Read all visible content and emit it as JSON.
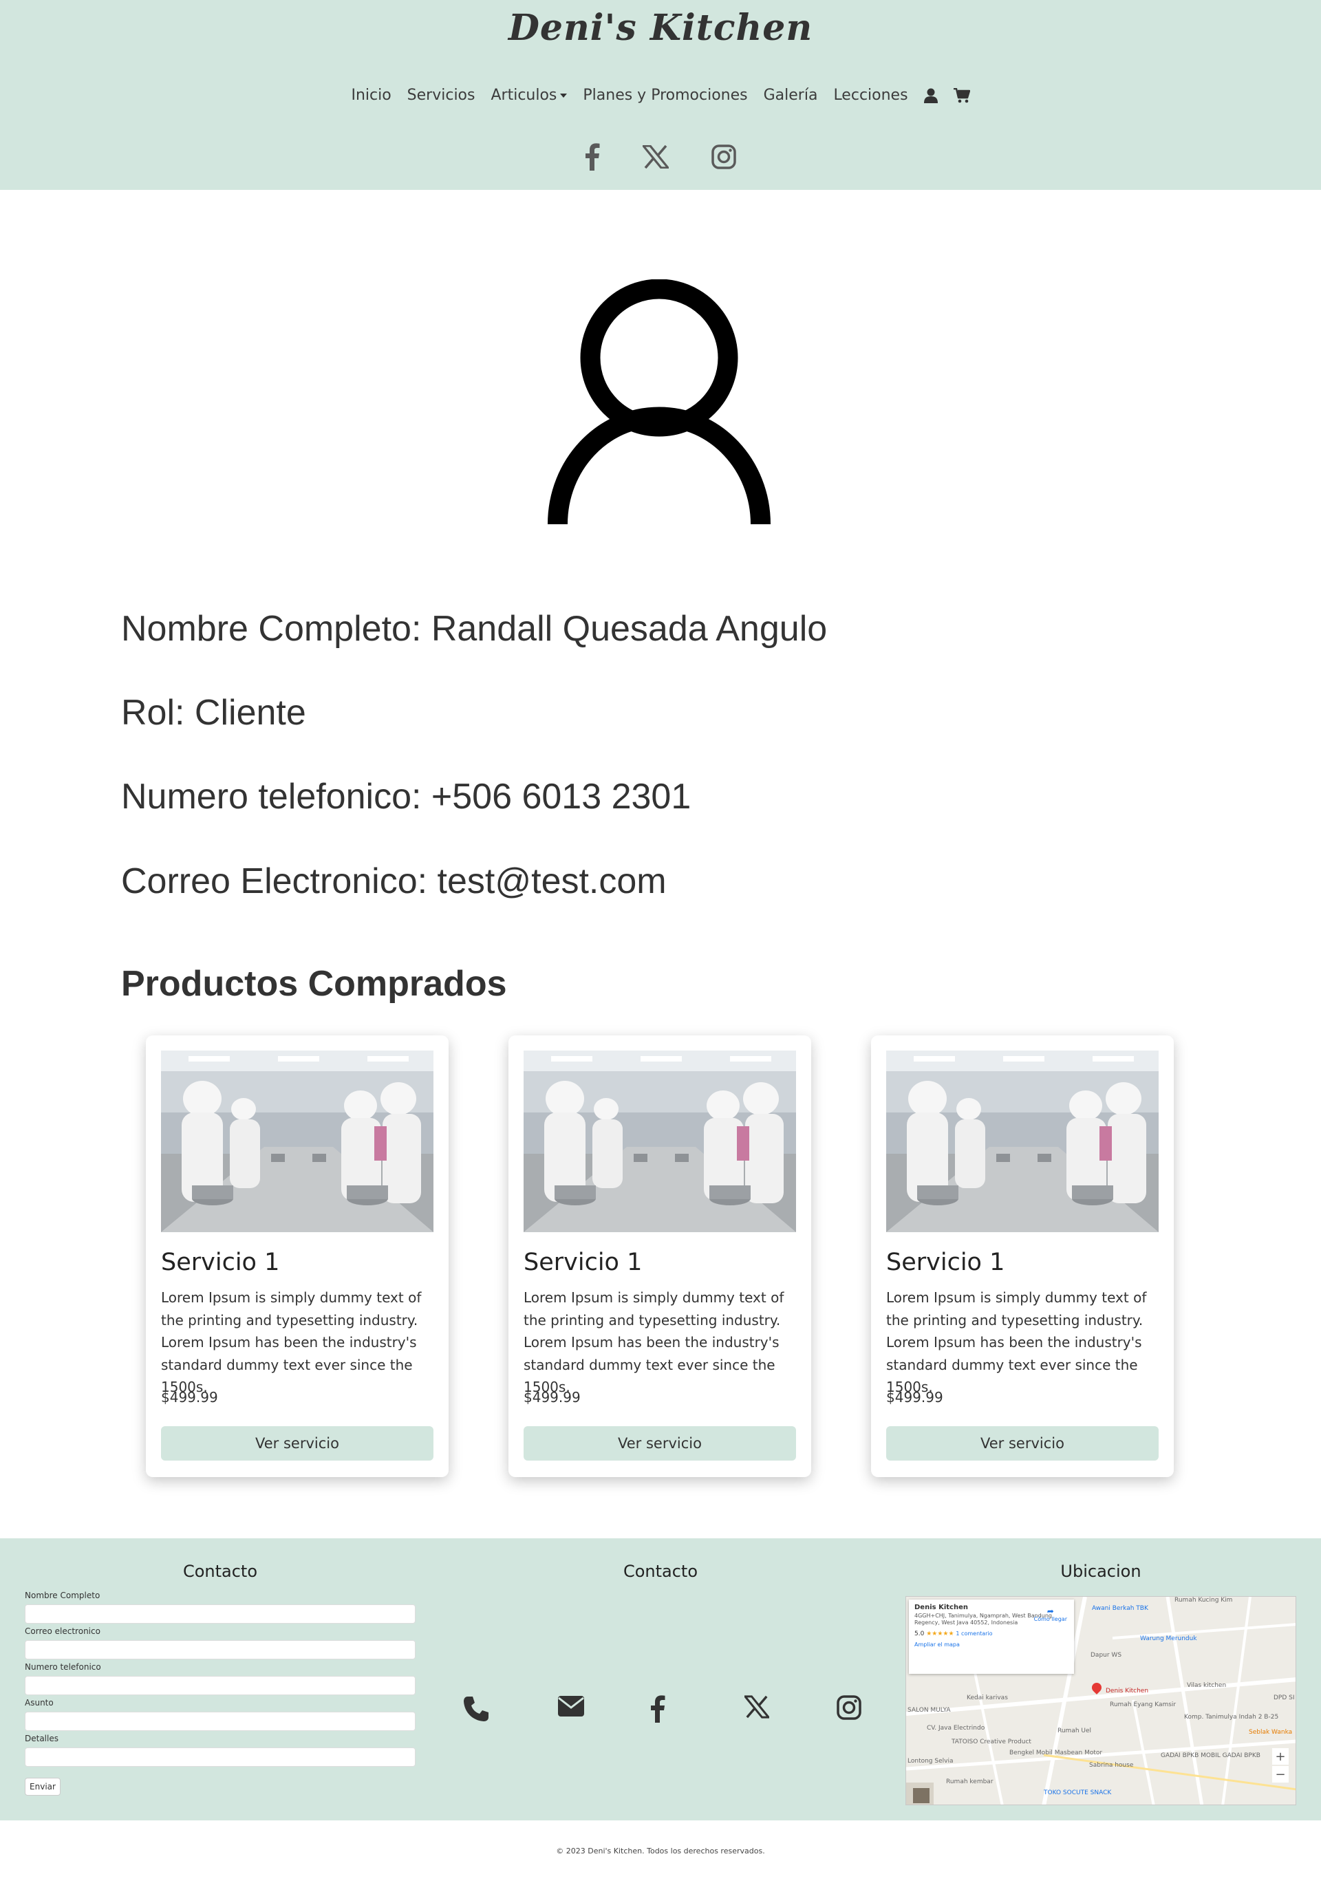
{
  "header": {
    "brand": "Deni's Kitchen",
    "nav": [
      {
        "label": "Inicio"
      },
      {
        "label": "Servicios"
      },
      {
        "label": "Articulos"
      },
      {
        "label": "Planes y Promociones"
      },
      {
        "label": "Galería"
      },
      {
        "label": "Lecciones"
      }
    ],
    "icons": [
      "user-icon",
      "cart-icon"
    ],
    "social": [
      "facebook-icon",
      "x-icon",
      "instagram-icon"
    ]
  },
  "profile": {
    "nombre": "Nombre Completo: Randall Quesada Angulo",
    "rol": "Rol: Cliente",
    "telefono": "Numero telefonico: +506 6013 2301",
    "correo": "Correo Electronico: test@test.com"
  },
  "products": {
    "title": "Productos Comprados",
    "items": [
      {
        "title": "Servicio 1",
        "text": "Lorem Ipsum is simply dummy text of the printing and typesetting industry. Lorem Ipsum has been the industry's standard dummy text ever since the 1500s.",
        "price": "$499.99",
        "button": "Ver servicio"
      },
      {
        "title": "Servicio 1",
        "text": "Lorem Ipsum is simply dummy text of the printing and typesetting industry. Lorem Ipsum has been the industry's standard dummy text ever since the 1500s.",
        "price": "$499.99",
        "button": "Ver servicio"
      },
      {
        "title": "Servicio 1",
        "text": "Lorem Ipsum is simply dummy text of the printing and typesetting industry. Lorem Ipsum has been the industry's standard dummy text ever since the 1500s.",
        "price": "$499.99",
        "button": "Ver servicio"
      }
    ]
  },
  "footer": {
    "form_title": "Contacto",
    "contact_title": "Contacto",
    "map_title": "Ubicacion",
    "fields": [
      "Nombre Completo",
      "Correo electronico",
      "Numero telefonico",
      "Asunto",
      "Detalles"
    ],
    "send": "Enviar",
    "icons": [
      "phone-icon",
      "envelope-icon",
      "facebook-icon",
      "x-icon",
      "instagram-icon"
    ],
    "map": {
      "place": "Denis Kitchen",
      "address": "4GGH+CHJ, Tanimulya, Ngamprah, West Bandung Regency, West Java 40552, Indonesia",
      "rating": "5.0",
      "stars": "★★★★★",
      "reviews": "1 comentario",
      "enlarge": "Ampliar el mapa",
      "directions": "Cómo llegar",
      "pin_label": "Denis Kitchen",
      "labels": [
        "Awani Berkah TBK",
        "Warung Merunduk",
        "Dapur WS",
        "Kedai karivas",
        "Rumah Eyang Kamsir",
        "CV. Java Electrindo",
        "Rumah Uel",
        "TATOISO Creative Product",
        "Bengkel Mobil Masbean Motor",
        "Sabrina house",
        "GADAI BPKB MOBIL GADAI BPKB",
        "Rumah kembar",
        "TOKO SOCUTE SNACK",
        "Vilas kitchen",
        "Komp. Tanimulya Indah 2 B-25",
        "Seblak Wanka",
        "Rumah Kucing Kim",
        "SALON MULYA",
        "Lontong Selvia",
        "DPD SI WIRAB"
      ],
      "zoom_in": "+",
      "zoom_out": "−"
    }
  },
  "copyright": "© 2023 Deni's Kitchen. Todos los derechos reservados."
}
